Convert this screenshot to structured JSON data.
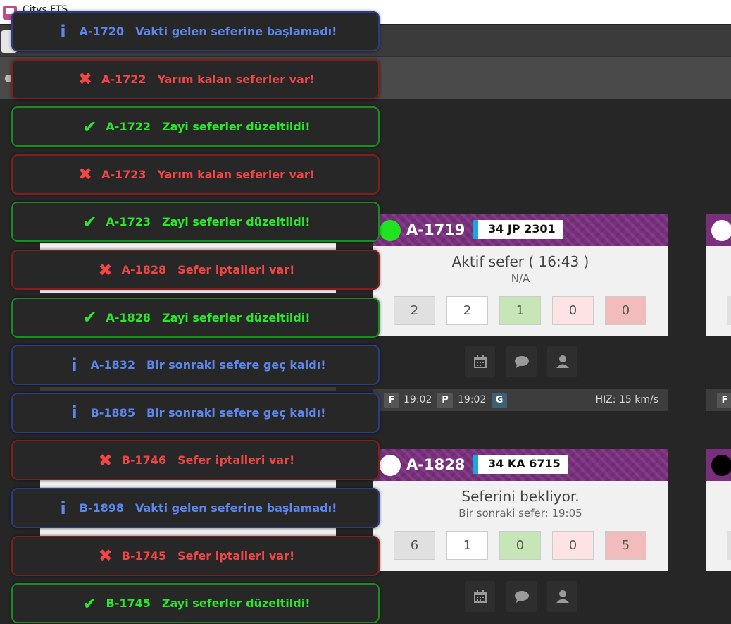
{
  "window": {
    "title": "Citys FTS"
  },
  "cards": [
    {
      "code": "A-1719",
      "dot_color": "#1fe41f",
      "plate": "34 JP 2301",
      "status": "Aktif sefer ( 16:43 )",
      "sub": "N/A",
      "counts": [
        "2",
        "2",
        "1",
        "0",
        "0"
      ],
      "footer": {
        "f_label": "F",
        "f_time": "19:02",
        "p_label": "P",
        "p_time": "19:02",
        "g_label": "G",
        "speed": "HIZ: 15 km/s"
      }
    },
    {
      "code": "A-1828",
      "dot_color": "#ffffff",
      "plate": "34 KA 6715",
      "status": "Seferini bekliyor.",
      "sub": "Bir sonraki sefer: 19:05",
      "counts": [
        "6",
        "1",
        "0",
        "0",
        "5"
      ]
    }
  ],
  "right_partial": {
    "f_label": "F"
  },
  "notifications": [
    {
      "type": "info",
      "icon": "info-icon",
      "code": "A-1720",
      "message": "Vakti gelen seferine başlamadı!"
    },
    {
      "type": "error",
      "icon": "x-icon",
      "code": "A-1722",
      "message": "Yarım kalan seferler var!"
    },
    {
      "type": "success",
      "icon": "check-icon",
      "code": "A-1722",
      "message": "Zayi seferler düzeltildi!"
    },
    {
      "type": "error",
      "icon": "x-icon",
      "code": "A-1723",
      "message": "Yarım kalan seferler var!"
    },
    {
      "type": "success",
      "icon": "check-icon",
      "code": "A-1723",
      "message": "Zayi seferler düzeltildi!"
    },
    {
      "type": "error",
      "icon": "x-icon",
      "code": "A-1828",
      "message": "Sefer iptalleri var!"
    },
    {
      "type": "success",
      "icon": "check-icon",
      "code": "A-1828",
      "message": "Zayi seferler düzeltildi!"
    },
    {
      "type": "info",
      "icon": "info-icon",
      "code": "A-1832",
      "message": "Bir sonraki sefere geç kaldı!"
    },
    {
      "type": "info",
      "icon": "info-icon",
      "code": "B-1885",
      "message": "Bir sonraki sefere geç kaldı!"
    },
    {
      "type": "error",
      "icon": "x-icon",
      "code": "B-1746",
      "message": "Sefer iptalleri var!"
    },
    {
      "type": "info",
      "icon": "info-icon",
      "code": "B-1898",
      "message": "Vakti gelen seferine başlamadı!"
    },
    {
      "type": "error",
      "icon": "x-icon",
      "code": "B-1745",
      "message": "Sefer iptalleri var!"
    },
    {
      "type": "success",
      "icon": "check-icon",
      "code": "B-1745",
      "message": "Zayi seferler düzeltildi!"
    }
  ]
}
